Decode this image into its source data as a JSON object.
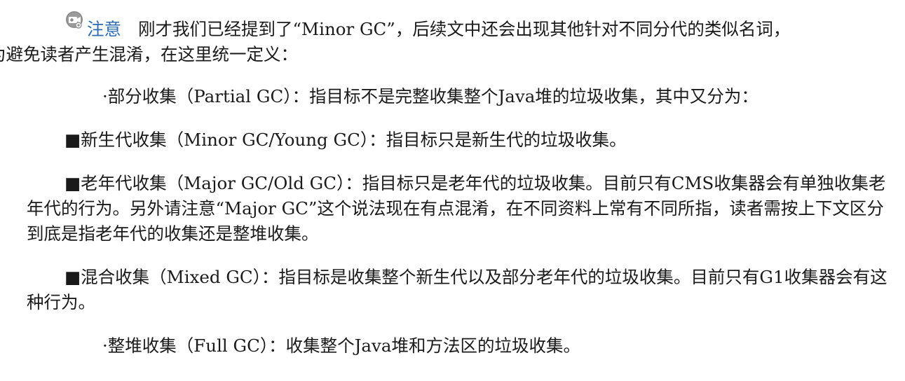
{
  "note": {
    "icon": "note-camera-icon",
    "label": "注意",
    "text_line1": "刚才我们已经提到了“Minor GC”，后续文中还会出现其他针对不同分代的类似名词，",
    "text_line2": "为避免读者产生混淆，在这里统一定义："
  },
  "items": [
    {
      "marker": "·",
      "text": "部分收集（Partial GC）：指目标不是完整收集整个Java堆的垃圾收集，其中又分为："
    },
    {
      "marker": "■",
      "text": "新生代收集（Minor GC/Young GC）：指目标只是新生代的垃圾收集。"
    },
    {
      "marker": "■",
      "text": "老年代收集（Major GC/Old GC）：指目标只是老年代的垃圾收集。目前只有CMS收集器会有单独收集老年代的行为。另外请注意“Major GC”这个说法现在有点混淆，在不同资料上常有不同所指，读者需按上下文区分到底是指老年代的收集还是整堆收集。"
    },
    {
      "marker": "■",
      "text": "混合收集（Mixed GC）：指目标是收集整个新生代以及部分老年代的垃圾收集。目前只有G1收集器会有这种行为。"
    },
    {
      "marker": "·",
      "text": "整堆收集（Full GC）：收集整个Java堆和方法区的垃圾收集。"
    }
  ],
  "colors": {
    "note_label": "#2b6cb0",
    "text": "#1a1a1a",
    "icon": "#7a7a7a"
  }
}
